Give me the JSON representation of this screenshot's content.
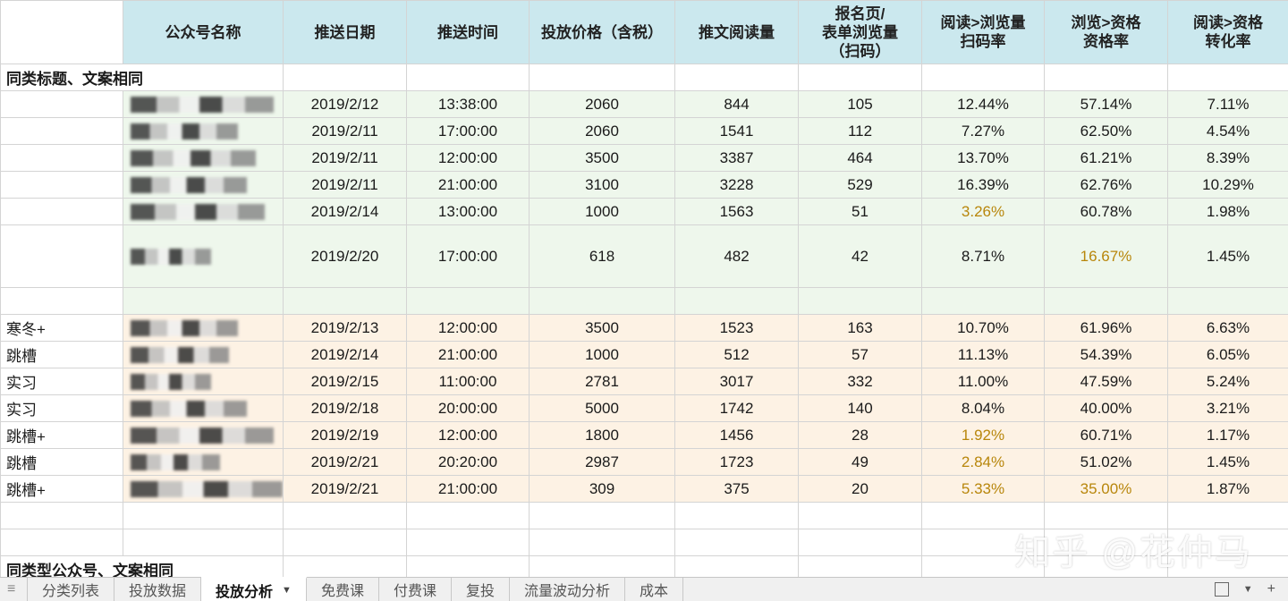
{
  "headers": [
    "",
    "公众号名称",
    "推送日期",
    "推送时间",
    "投放价格（含税）",
    "推文阅读量",
    "报名页/\n表单浏览量\n（扫码）",
    "阅读>浏览量\n扫码率",
    "浏览>资格\n资格率",
    "阅读>资格\n转化率"
  ],
  "section1_title": "同类标题、文案相同",
  "group1": [
    {
      "label": "",
      "date": "2019/2/12",
      "time": "13:38:00",
      "price": "2060",
      "reads": "844",
      "views": "105",
      "rate1": "12.44%",
      "rate2": "57.14%",
      "rate3": "7.11%"
    },
    {
      "label": "",
      "date": "2019/2/11",
      "time": "17:00:00",
      "price": "2060",
      "reads": "1541",
      "views": "112",
      "rate1": "7.27%",
      "rate2": "62.50%",
      "rate3": "4.54%"
    },
    {
      "label": "",
      "date": "2019/2/11",
      "time": "12:00:00",
      "price": "3500",
      "reads": "3387",
      "views": "464",
      "rate1": "13.70%",
      "rate2": "61.21%",
      "rate3": "8.39%"
    },
    {
      "label": "",
      "date": "2019/2/11",
      "time": "21:00:00",
      "price": "3100",
      "reads": "3228",
      "views": "529",
      "rate1": "16.39%",
      "rate2": "62.76%",
      "rate3": "10.29%"
    },
    {
      "label": "",
      "date": "2019/2/14",
      "time": "13:00:00",
      "price": "1000",
      "reads": "1563",
      "views": "51",
      "rate1": "3.26%",
      "rate2": "60.78%",
      "rate3": "1.98%"
    },
    {
      "label": "",
      "date": "2019/2/20",
      "time": "17:00:00",
      "price": "618",
      "reads": "482",
      "views": "42",
      "rate1": "8.71%",
      "rate2": "16.67%",
      "rate3": "1.45%"
    }
  ],
  "group2": [
    {
      "label": "寒冬+",
      "date": "2019/2/13",
      "time": "12:00:00",
      "price": "3500",
      "reads": "1523",
      "views": "163",
      "rate1": "10.70%",
      "rate2": "61.96%",
      "rate3": "6.63%"
    },
    {
      "label": "跳槽",
      "date": "2019/2/14",
      "time": "21:00:00",
      "price": "1000",
      "reads": "512",
      "views": "57",
      "rate1": "11.13%",
      "rate2": "54.39%",
      "rate3": "6.05%"
    },
    {
      "label": "实习",
      "date": "2019/2/15",
      "time": "11:00:00",
      "price": "2781",
      "reads": "3017",
      "views": "332",
      "rate1": "11.00%",
      "rate2": "47.59%",
      "rate3": "5.24%"
    },
    {
      "label": "实习",
      "date": "2019/2/18",
      "time": "20:00:00",
      "price": "5000",
      "reads": "1742",
      "views": "140",
      "rate1": "8.04%",
      "rate2": "40.00%",
      "rate3": "3.21%"
    },
    {
      "label": "跳槽+",
      "date": "2019/2/19",
      "time": "12:00:00",
      "price": "1800",
      "reads": "1456",
      "views": "28",
      "rate1": "1.92%",
      "rate2": "60.71%",
      "rate3": "1.17%"
    },
    {
      "label": "跳槽",
      "date": "2019/2/21",
      "time": "20:20:00",
      "price": "2987",
      "reads": "1723",
      "views": "49",
      "rate1": "2.84%",
      "rate2": "51.02%",
      "rate3": "1.45%"
    },
    {
      "label": "跳槽+",
      "date": "2019/2/21",
      "time": "21:00:00",
      "price": "309",
      "reads": "375",
      "views": "20",
      "rate1": "5.33%",
      "rate2": "35.00%",
      "rate3": "1.87%"
    }
  ],
  "section2_title": "同类型公众号、文案相同",
  "watermark": "知乎 @花仲马",
  "tabs": [
    "分类列表",
    "投放数据",
    "投放分析",
    "免费课",
    "付费课",
    "复投",
    "流量波动分析",
    "成本"
  ],
  "active_tab": "投放分析",
  "colors": {
    "header_bg": "#cbe8ee",
    "group1_bg": "#eef7ec",
    "group2_bg": "#fdf2e4",
    "highlight_text": "#b8860b"
  },
  "icons": {
    "tab_menu": "chevron-down-icon",
    "sheet_list": "sheet-icon",
    "scroll_menu": "chevron-down-icon",
    "add_sheet": "plus-icon"
  }
}
